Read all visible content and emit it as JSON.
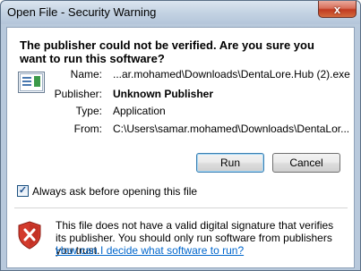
{
  "window": {
    "title": "Open File - Security Warning",
    "close_glyph": "x"
  },
  "headline": "The publisher could not be verified.  Are you sure you want to run this software?",
  "fields": [
    {
      "label": "Name:",
      "value": "...ar.mohamed\\Downloads\\DentaLore.Hub (2).exe"
    },
    {
      "label": "Publisher:",
      "value": "Unknown Publisher"
    },
    {
      "label": "Type:",
      "value": "Application"
    },
    {
      "label": "From:",
      "value": "C:\\Users\\samar.mohamed\\Downloads\\DentaLor..."
    }
  ],
  "buttons": {
    "run": "Run",
    "cancel": "Cancel"
  },
  "checkbox": {
    "label": "Always ask before opening this file",
    "checked": true
  },
  "warning": {
    "text": "This file does not have a valid digital signature that verifies its publisher.  You should only run software from publishers you trust.",
    "link": "How can I decide what software to run?"
  },
  "icons": {
    "file": "application-file-icon",
    "shield": "shield-error-icon"
  },
  "colors": {
    "link": "#0066cc",
    "close": "#c13b20",
    "shield": "#d33a2c"
  }
}
